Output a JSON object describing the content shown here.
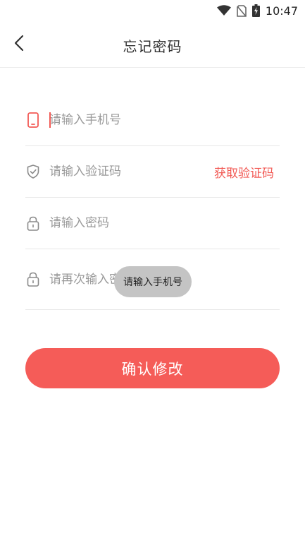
{
  "status_bar": {
    "time": "10:47",
    "icons": [
      "wifi-icon",
      "no-sim-icon",
      "battery-charging-icon"
    ]
  },
  "header": {
    "title": "忘记密码",
    "back_icon": "chevron-left-icon"
  },
  "form": {
    "phone": {
      "placeholder": "请输入手机号",
      "icon": "phone-icon",
      "icon_color": "#f25a55"
    },
    "code": {
      "placeholder": "请输入验证码",
      "icon": "shield-check-icon",
      "get_code_label": "获取验证码"
    },
    "password": {
      "placeholder": "请输入密码",
      "icon": "lock-icon"
    },
    "confirm_password": {
      "placeholder": "请再次输入密码",
      "icon": "lock-icon"
    }
  },
  "toast": {
    "text": "请输入手机号"
  },
  "submit": {
    "label": "确认修改",
    "color": "#f55c58"
  },
  "colors": {
    "accent": "#f25a55",
    "placeholder": "#9a9a9a",
    "divider": "#e8e8e8"
  }
}
